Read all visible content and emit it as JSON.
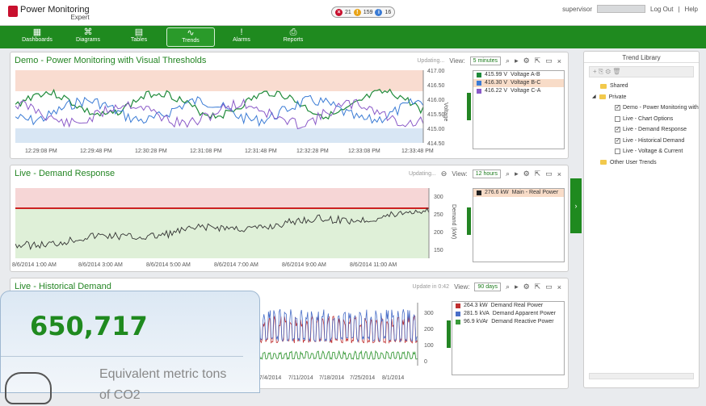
{
  "app": {
    "brand": "Power Monitoring",
    "brand_sub": "Expert"
  },
  "alerts": {
    "critical": "21",
    "warning": "159",
    "info": "16"
  },
  "user": {
    "name": "supervisor",
    "logout": "Log Out",
    "help": "Help"
  },
  "nav": [
    {
      "label": "Dashboards",
      "icon": "▦"
    },
    {
      "label": "Diagrams",
      "icon": "⌘"
    },
    {
      "label": "Tables",
      "icon": "▤"
    },
    {
      "label": "Trends",
      "icon": "∿"
    },
    {
      "label": "Alarms",
      "icon": "!"
    },
    {
      "label": "Reports",
      "icon": "⎙"
    }
  ],
  "colors": {
    "brand_green": "#1f8a1f",
    "red": "#c8102e",
    "blue": "#3a7bd5",
    "purple": "#8a5ac8"
  },
  "panels": {
    "p1": {
      "title": "Demo - Power Monitoring with Visual Thresholds",
      "status": "Updating...",
      "view_label": "View:",
      "view_value": "5 minutes",
      "yaxis_title": "Voltage",
      "y_ticks": [
        "417.00",
        "416.50",
        "416.00",
        "415.50",
        "415.00",
        "414.50"
      ],
      "x_ticks": [
        "12:29:08 PM",
        "12:29:48 PM",
        "12:30:28 PM",
        "12:31:08 PM",
        "12:31:48 PM",
        "12:32:28 PM",
        "12:33:08 PM",
        "12:33:48 PM"
      ],
      "legend": [
        {
          "value": "415.99 V",
          "name": "Voltage A-B",
          "color": "#1f8a3a"
        },
        {
          "value": "416.30 V",
          "name": "Voltage B-C",
          "color": "#3a7bd5"
        },
        {
          "value": "416.22 V",
          "name": "Voltage C-A",
          "color": "#8a5ac8"
        }
      ]
    },
    "p2": {
      "title": "Live - Demand Response",
      "status": "Updating...",
      "view_label": "View:",
      "view_value": "12 hours",
      "yaxis_title": "Demand (kW)",
      "y_ticks": [
        "300",
        "250",
        "200",
        "150"
      ],
      "x_ticks": [
        "8/6/2014 1:00 AM",
        "8/6/2014 3:00 AM",
        "8/6/2014 5:00 AM",
        "8/6/2014 7:00 AM",
        "8/6/2014 9:00 AM",
        "8/6/2014 11:00 AM"
      ],
      "legend": [
        {
          "value": "276.6 kW",
          "name": "Main - Real Power",
          "color": "#222222"
        }
      ]
    },
    "p3": {
      "title": "Live - Historical Demand",
      "status": "Update in 0:42",
      "view_label": "View:",
      "view_value": "90 days",
      "y_ticks": [
        "300",
        "200",
        "100",
        "0"
      ],
      "x_ticks": [
        "7/4/2014",
        "7/11/2014",
        "7/18/2014",
        "7/25/2014",
        "8/1/2014"
      ],
      "legend": [
        {
          "value": "264.3 kW",
          "name": "Demand Real Power",
          "color": "#c03030"
        },
        {
          "value": "281.5 kVA",
          "name": "Demand Apparent Power",
          "color": "#4a6fc8"
        },
        {
          "value": "96.9 kVAr",
          "name": "Demand Reactive Power",
          "color": "#3a9a3a"
        }
      ]
    }
  },
  "library": {
    "title": "Trend Library",
    "shared": "Shared",
    "private": "Private",
    "items": [
      {
        "label": "Demo - Power Monitoring with",
        "checked": true
      },
      {
        "label": "Live - Chart Options",
        "checked": false
      },
      {
        "label": "Live - Demand Response",
        "checked": true
      },
      {
        "label": "Live - Historical Demand",
        "checked": true
      },
      {
        "label": "Live - Voltage & Current",
        "checked": false
      }
    ],
    "other": "Other User Trends"
  },
  "overlay": {
    "value": "650,717",
    "caption": "Equivalent metric tons of CO2"
  }
}
